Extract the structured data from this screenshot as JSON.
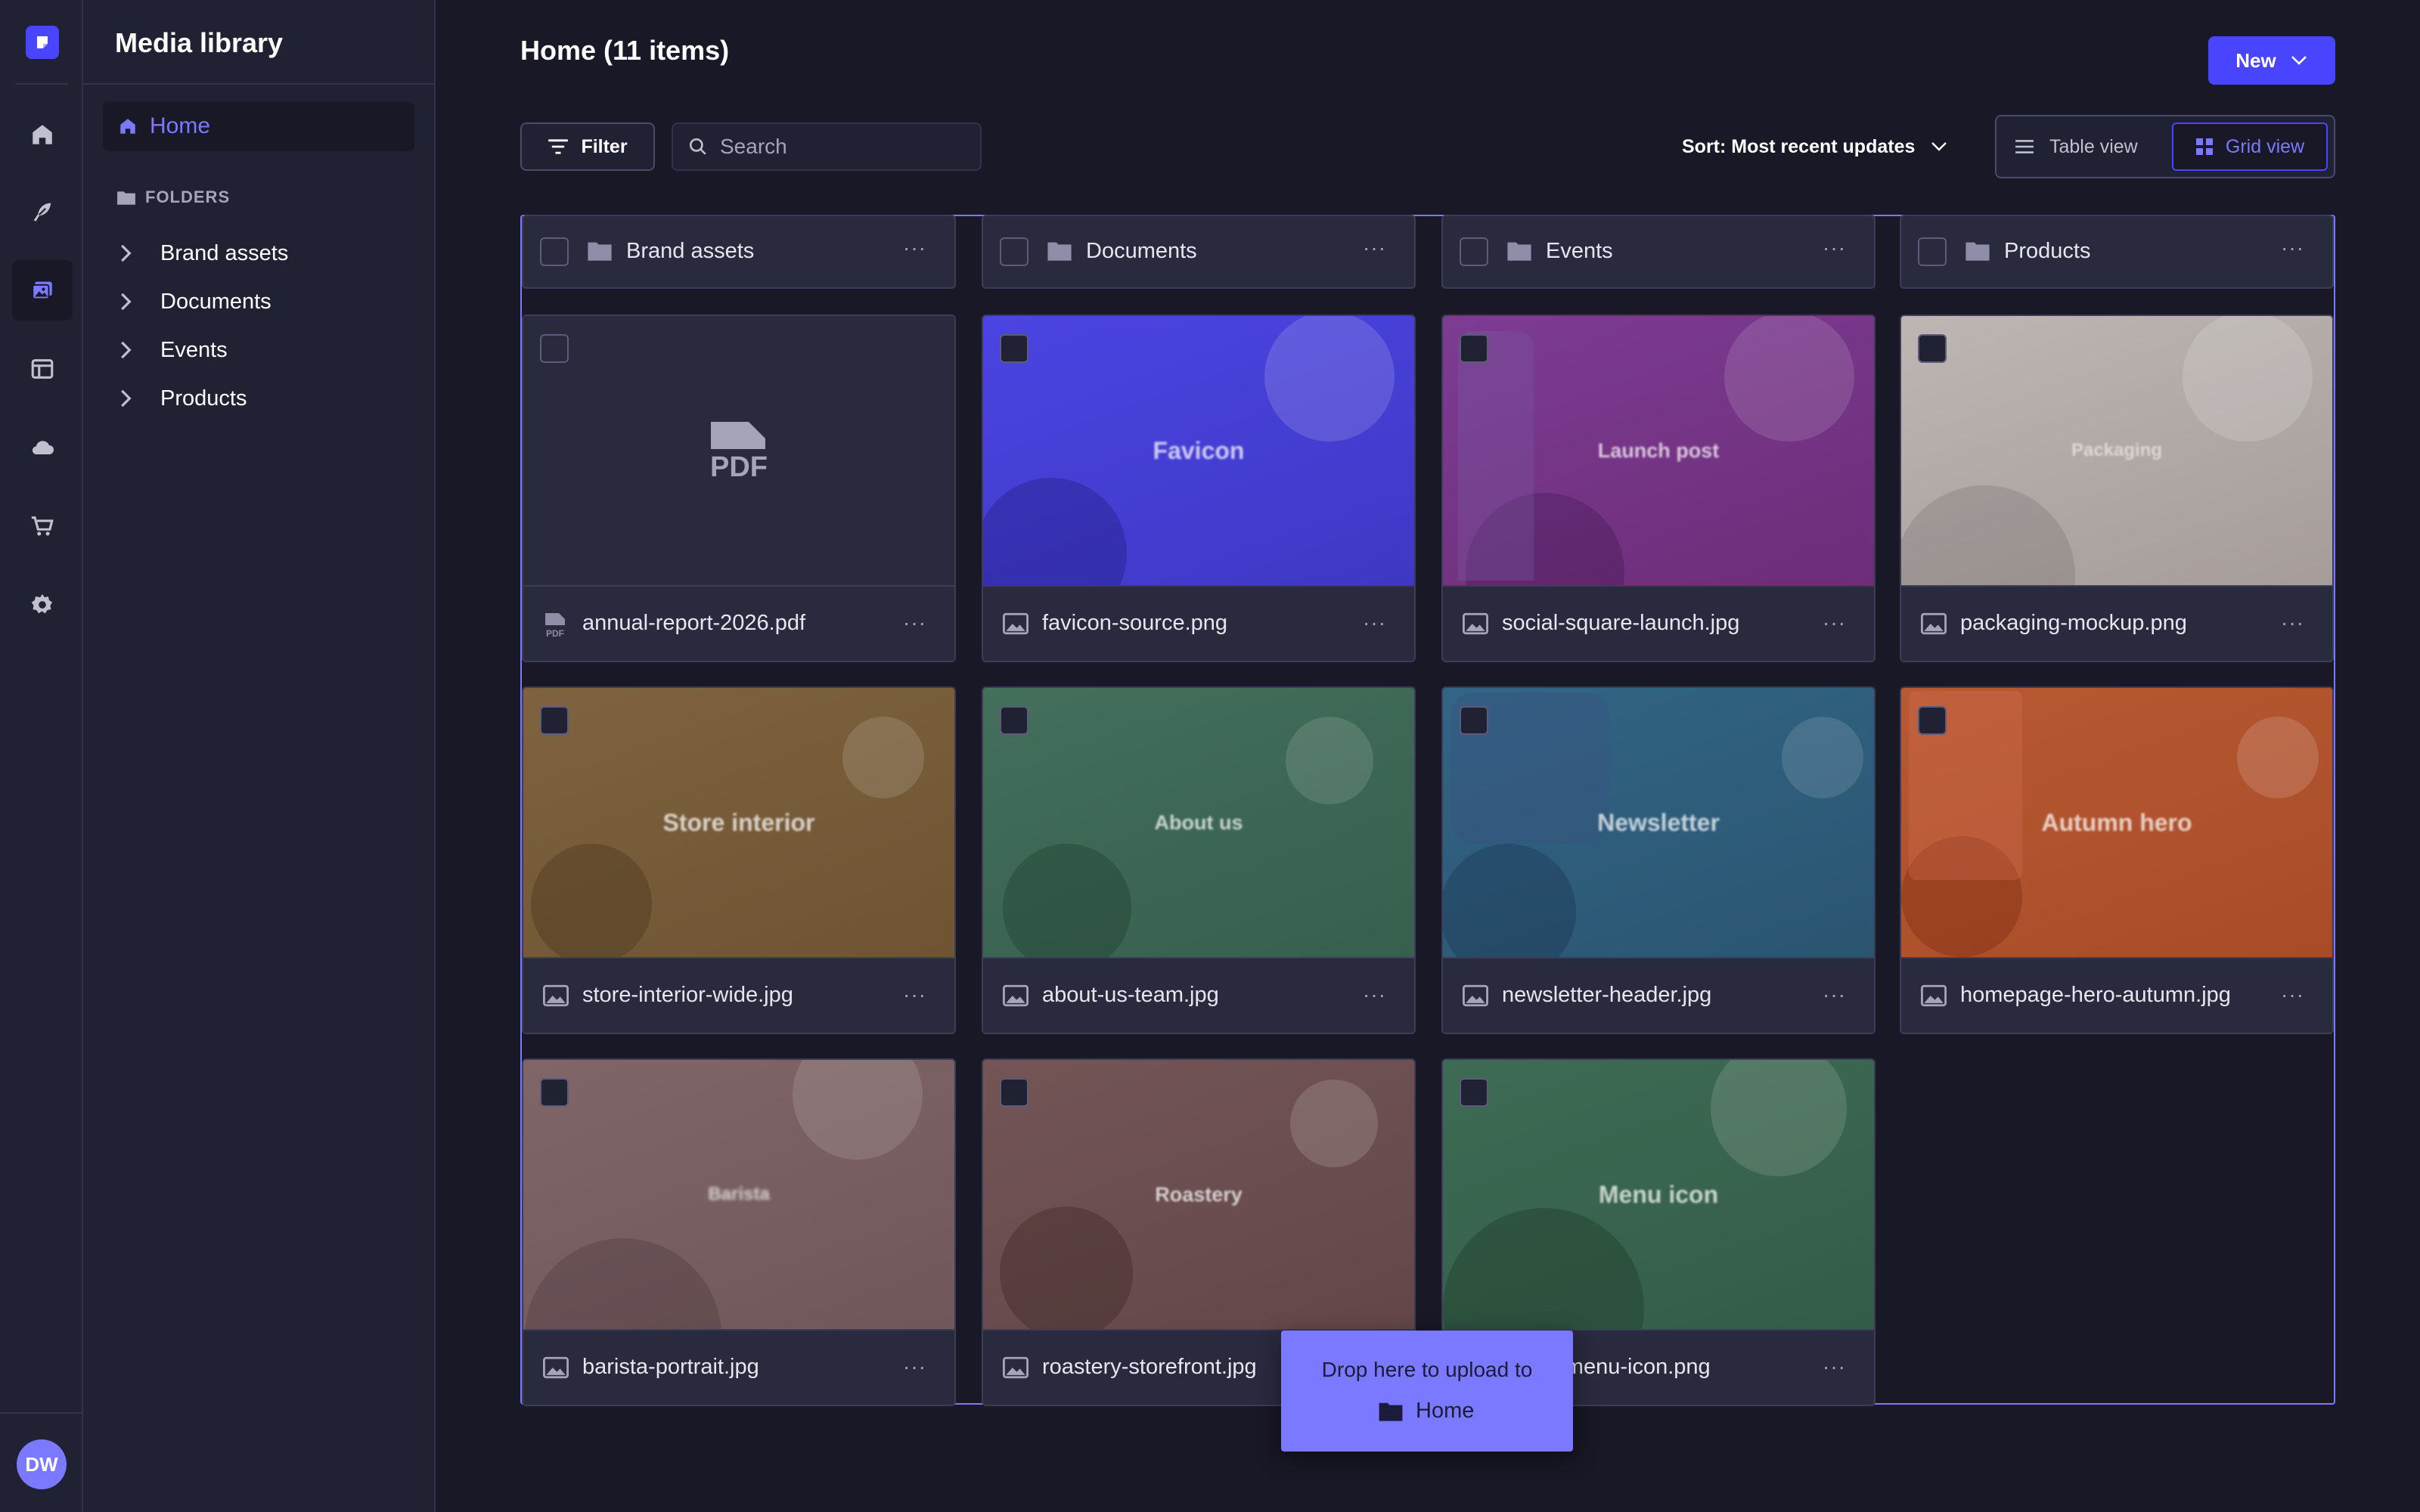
{
  "app": {
    "title": "Media library",
    "user_initials": "DW"
  },
  "rail": {
    "items": [
      "home-icon",
      "feather-icon",
      "media-icon",
      "layout-icon",
      "cloud-icon",
      "cart-icon",
      "gear-icon"
    ],
    "active": "media-icon"
  },
  "subnav": {
    "home_label": "Home",
    "folders_heading": "FOLDERS",
    "folders": [
      "Brand assets",
      "Documents",
      "Events",
      "Products"
    ]
  },
  "header": {
    "title": "Home (11 items)",
    "new_label": "New"
  },
  "toolbar": {
    "filter_label": "Filter",
    "search_placeholder": "Search",
    "sort_label": "Sort: Most recent updates",
    "table_view_label": "Table view",
    "grid_view_label": "Grid view",
    "active_view": "grid"
  },
  "folder_cards": [
    {
      "name": "Brand assets"
    },
    {
      "name": "Documents"
    },
    {
      "name": "Events"
    },
    {
      "name": "Products"
    }
  ],
  "assets": [
    {
      "file": "annual-report-2026.pdf",
      "type": "pdf",
      "thumb_text": "PDF",
      "color": "#2a2a3f"
    },
    {
      "file": "favicon-source.png",
      "type": "image",
      "thumb_text": "Favicon",
      "color": "#4a41d6"
    },
    {
      "file": "social-square-launch.jpg",
      "type": "image",
      "thumb_text": "Launch post",
      "color": "#7b3a8e"
    },
    {
      "file": "packaging-mockup.png",
      "type": "image",
      "thumb_text": "Packaging",
      "color": "#b3aaa7"
    },
    {
      "file": "store-interior-wide.jpg",
      "type": "image",
      "thumb_text": "Store interior",
      "color": "#7a5e3c"
    },
    {
      "file": "about-us-team.jpg",
      "type": "image",
      "thumb_text": "About us",
      "color": "#3f6a58"
    },
    {
      "file": "newsletter-header.jpg",
      "type": "image",
      "thumb_text": "Newsletter",
      "color": "#2f5f7c"
    },
    {
      "file": "homepage-hero-autumn.jpg",
      "type": "image",
      "thumb_text": "Autumn hero",
      "color": "#b4532e"
    },
    {
      "file": "barista-portrait.jpg",
      "type": "image",
      "thumb_text": "Barista",
      "color": "#7a5e62"
    },
    {
      "file": "roastery-storefront.jpg",
      "type": "image",
      "thumb_text": "Roastery",
      "color": "#6e4f51"
    },
    {
      "file": "social-menu-icon.png",
      "type": "image",
      "thumb_text": "Menu icon",
      "color": "#3b6651"
    }
  ],
  "drop_tooltip": {
    "line1": "Drop here to upload to",
    "target": "Home"
  },
  "colors": {
    "accent": "#4945ff",
    "accent_light": "#7b79ff",
    "bg": "#181826",
    "panel": "#212134"
  }
}
